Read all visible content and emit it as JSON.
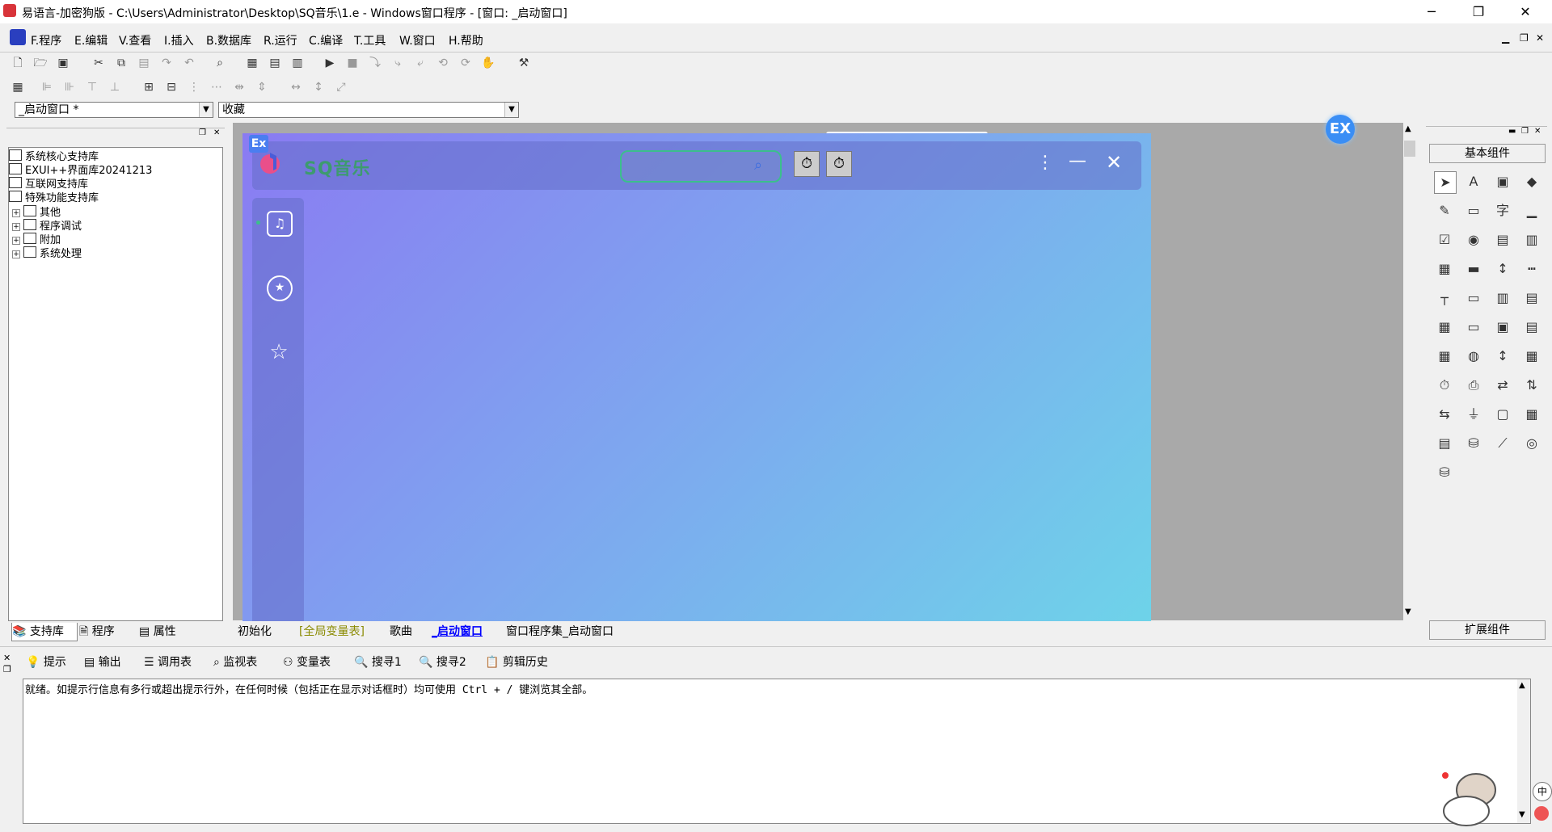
{
  "window": {
    "title": "易语言-加密狗版 - C:\\Users\\Administrator\\Desktop\\SQ音乐\\1.e - Windows窗口程序 - [窗口: _启动窗口]",
    "minimize": "─",
    "restore": "❐",
    "close": "✕"
  },
  "menu": [
    "F.程序",
    "E.编辑",
    "V.查看",
    "I.插入",
    "B.数据库",
    "R.运行",
    "C.编译",
    "T.工具",
    "W.窗口",
    "H.帮助"
  ],
  "combos": {
    "window_select": "_启动窗口 *",
    "favorites": "收藏"
  },
  "left_panel": {
    "tree": [
      {
        "label": "系统核心支持库",
        "type": "lib"
      },
      {
        "label": "EXUI++界面库20241213",
        "type": "lib"
      },
      {
        "label": "互联网支持库",
        "type": "lib"
      },
      {
        "label": "特殊功能支持库",
        "type": "lib"
      },
      {
        "label": "其他",
        "type": "folder"
      },
      {
        "label": "程序调试",
        "type": "folder"
      },
      {
        "label": "附加",
        "type": "folder"
      },
      {
        "label": "系统处理",
        "type": "folder"
      }
    ],
    "tabs": [
      "支持库",
      "程序",
      "属性"
    ]
  },
  "editor_tabs": [
    "初始化",
    "[全局变量表]",
    "歌曲",
    "_启动窗口",
    "窗口程序集_启动窗口"
  ],
  "form": {
    "app_title": "SQ音乐",
    "badge": "Ex"
  },
  "right_panel": {
    "basic_components": "基本组件",
    "extended_components": "扩展组件"
  },
  "bottom_tabs": [
    "提示",
    "输出",
    "调用表",
    "监视表",
    "变量表",
    "搜寻1",
    "搜寻2",
    "剪辑历史"
  ],
  "output_text": "就绪。如提示行信息有多行或超出提示行外，在任何时候（包括正在显示对话框时）均可使用 Ctrl + / 键浏览其全部。",
  "ime": "中",
  "colors": {
    "accent": "#0000ff",
    "form_gradient_start": "#8a7bf2",
    "form_gradient_end": "#6ed3e9",
    "designer_bg": "#a9a9a9"
  }
}
